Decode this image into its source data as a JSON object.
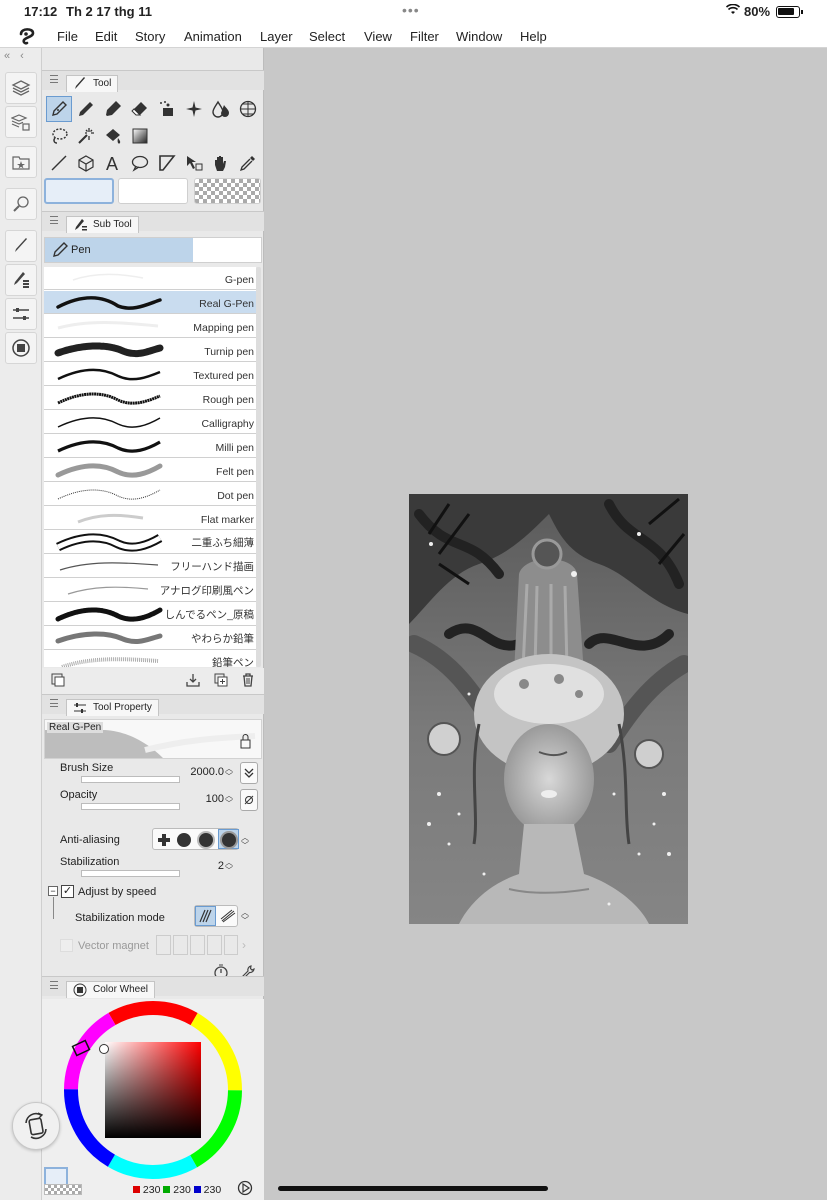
{
  "status_bar": {
    "time": "17:12",
    "date": "Th 2 17 thg 11",
    "battery": "80%"
  },
  "menu": {
    "items": [
      "File",
      "Edit",
      "Story",
      "Animation",
      "Layer",
      "Select",
      "View",
      "Filter",
      "Window",
      "Help"
    ]
  },
  "panels": {
    "tool": {
      "title": "Tool",
      "icons": [
        "pen-icon",
        "pencil-icon",
        "marker-icon",
        "eraser-icon",
        "decoration-icon",
        "sparkle-icon",
        "blend-icon",
        "crop-grid-icon",
        "lasso-icon",
        "magic-wand-icon",
        "fill-bucket-icon",
        "gradient-icon",
        "line-icon",
        "3d-object-icon",
        "text-icon",
        "balloon-icon",
        "frame-border-icon",
        "object-select-icon",
        "hand-icon",
        "eyedropper-icon"
      ],
      "active_tool": "pen-icon"
    },
    "subtool": {
      "title": "Sub Tool",
      "group": "Pen",
      "brushes": [
        {
          "name": "G-pen",
          "active": false
        },
        {
          "name": "Real G-Pen",
          "active": true
        },
        {
          "name": "Mapping pen",
          "active": false
        },
        {
          "name": "Turnip pen",
          "active": false
        },
        {
          "name": "Textured pen",
          "active": false
        },
        {
          "name": "Rough pen",
          "active": false
        },
        {
          "name": "Calligraphy",
          "active": false
        },
        {
          "name": "Milli pen",
          "active": false
        },
        {
          "name": "Felt pen",
          "active": false
        },
        {
          "name": "Dot pen",
          "active": false
        },
        {
          "name": "Flat marker",
          "active": false
        },
        {
          "name": "二重ふち細薄",
          "active": false
        },
        {
          "name": "フリーハンド描画",
          "active": false
        },
        {
          "name": "アナログ印刷風ペン",
          "active": false
        },
        {
          "name": "しんでるペン_原稿",
          "active": false
        },
        {
          "name": "やわらか鉛筆",
          "active": false
        },
        {
          "name": "鉛筆ペン",
          "active": false
        }
      ]
    },
    "tool_property": {
      "title": "Tool Property",
      "preview_label": "Real G-Pen",
      "brush_size_label": "Brush Size",
      "brush_size": "2000.0",
      "opacity_label": "Opacity",
      "opacity": "100",
      "anti_aliasing_label": "Anti-aliasing",
      "stabilization_label": "Stabilization",
      "stabilization": "2",
      "adjust_by_speed_label": "Adjust by speed",
      "stabilization_mode_label": "Stabilization mode",
      "vector_magnet_label": "Vector magnet"
    },
    "color_wheel": {
      "title": "Color Wheel",
      "r": "230",
      "g": "230",
      "b": "230",
      "main_color": "#e6eef8"
    }
  }
}
